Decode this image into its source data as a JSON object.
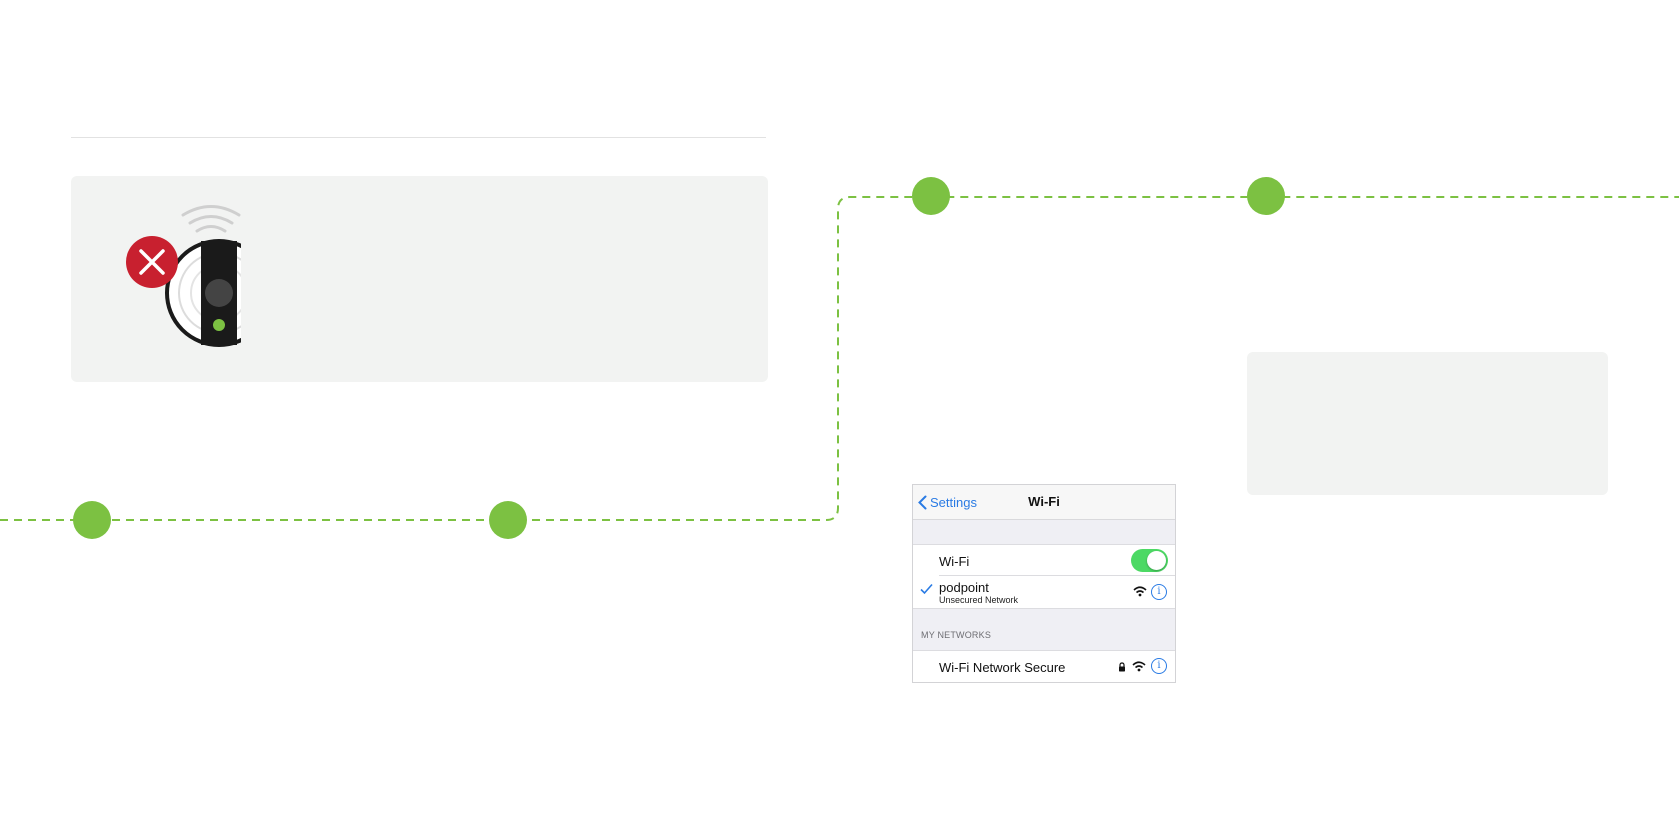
{
  "colors": {
    "accent_green": "#7cc142",
    "error_red": "#c8202f",
    "ios_blue": "#2a7be4",
    "toggle_green": "#4cd964",
    "card_bg": "#f2f3f2"
  },
  "icons": {
    "charger": "charger-offline-icon",
    "error": "close-icon",
    "signal": "signal-waves-icon"
  },
  "wifi_settings": {
    "back_label": "Settings",
    "title": "Wi-Fi",
    "wifi_label": "Wi-Fi",
    "wifi_enabled": true,
    "connected_network": {
      "name": "podpoint",
      "subtitle": "Unsecured Network"
    },
    "section_header": "MY NETWORKS",
    "saved_network": {
      "name": "Wi-Fi Network Secure"
    }
  }
}
